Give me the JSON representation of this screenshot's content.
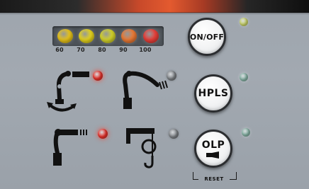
{
  "load_indicator": {
    "ticks": [
      "60",
      "70",
      "80",
      "90",
      "100"
    ],
    "led_colors": [
      "#e6c21a",
      "#e3d21e",
      "#d2d12a",
      "#ea7a36",
      "#e8403a"
    ]
  },
  "function_indicators": {
    "slew_led_color": "#e2312a",
    "telescope_led_color": "#7f8387",
    "tilt_led_color": "#e2312a",
    "hook_led_color": "#7f8387"
  },
  "buttons": {
    "on_off": {
      "label": "ON/OFF",
      "status_led_color": "#c9d36a"
    },
    "hpls": {
      "label": "HPLS",
      "status_led_color": "#86b3a5"
    },
    "olp": {
      "label": "OLP",
      "status_led_color": "#86b3a5",
      "reset_label": "RESET"
    }
  },
  "icons": [
    "crane-slew-icon",
    "crane-telescope-icon",
    "crane-boom-extend-icon",
    "crane-hook-icon",
    "horn-icon"
  ]
}
